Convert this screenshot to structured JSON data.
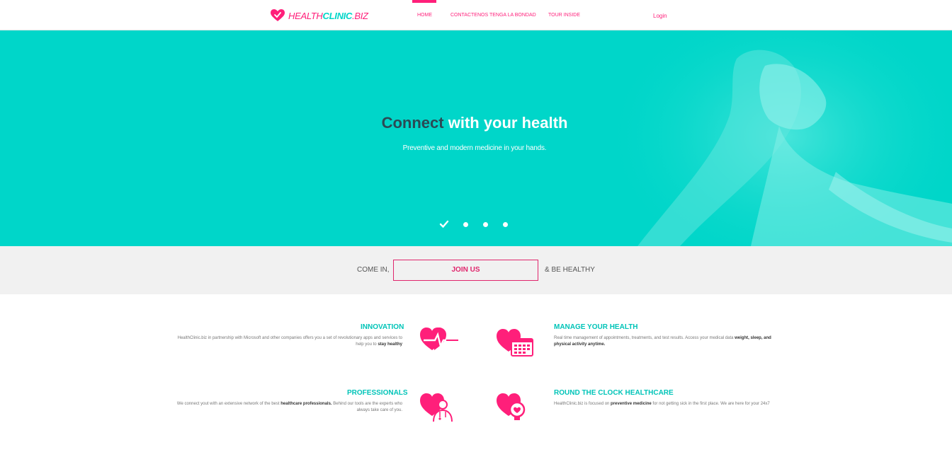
{
  "brand": {
    "logo_part1": "HEALTH",
    "logo_part2": "CLINIC",
    "logo_part3": ".BIZ",
    "primary_color": "#ff1f7a",
    "accent_color": "#00d6c9"
  },
  "nav": {
    "items": [
      {
        "label": "HOME",
        "active": true
      },
      {
        "label": "CONTACTENOS TENGA LA BONDAD",
        "active": false
      },
      {
        "label": "TOUR INSIDE",
        "active": false
      }
    ],
    "login_label": "Login"
  },
  "hero": {
    "title_part1": "Connect",
    "title_part2": "with your health",
    "subtitle": "Preventive and modern medicine in your hands.",
    "slide_count": 4,
    "active_slide": 1
  },
  "join_band": {
    "left_text": "COME IN,",
    "button_label": "JOIN US",
    "right_text": "& BE HEALTHY"
  },
  "features": {
    "innovation": {
      "title": "INNOVATION",
      "text": "HealthClinic.biz in partnership with Microsoft and other companies offers you a set of revolutionary apps and services to help you to ",
      "bold": "stay healthy",
      "icon": "heart-pulse-icon"
    },
    "manage": {
      "title": "MANAGE YOUR HEALTH",
      "text": "Real time management of appointments, treatments, and test results. Access your medical data ",
      "bold": "weight, sleep, and physical activity anytime.",
      "icon": "heart-calendar-icon"
    },
    "professionals": {
      "title": "PROFESSIONALS",
      "text_before": "We connect yout with an extensive network of the best ",
      "bold": "healthcare professionals.",
      "text_after": " Behind our tools are the experts who always take care of you.",
      "icon": "heart-doctor-icon"
    },
    "round_clock": {
      "title": "ROUND THE CLOCK HEALTHCARE",
      "text_before": "HealthClinic.biz is focused on ",
      "bold": "preventive medicine",
      "text_after": " for not getting sick in the first place. We are here for your 24x7",
      "icon": "heart-watch-icon"
    }
  }
}
